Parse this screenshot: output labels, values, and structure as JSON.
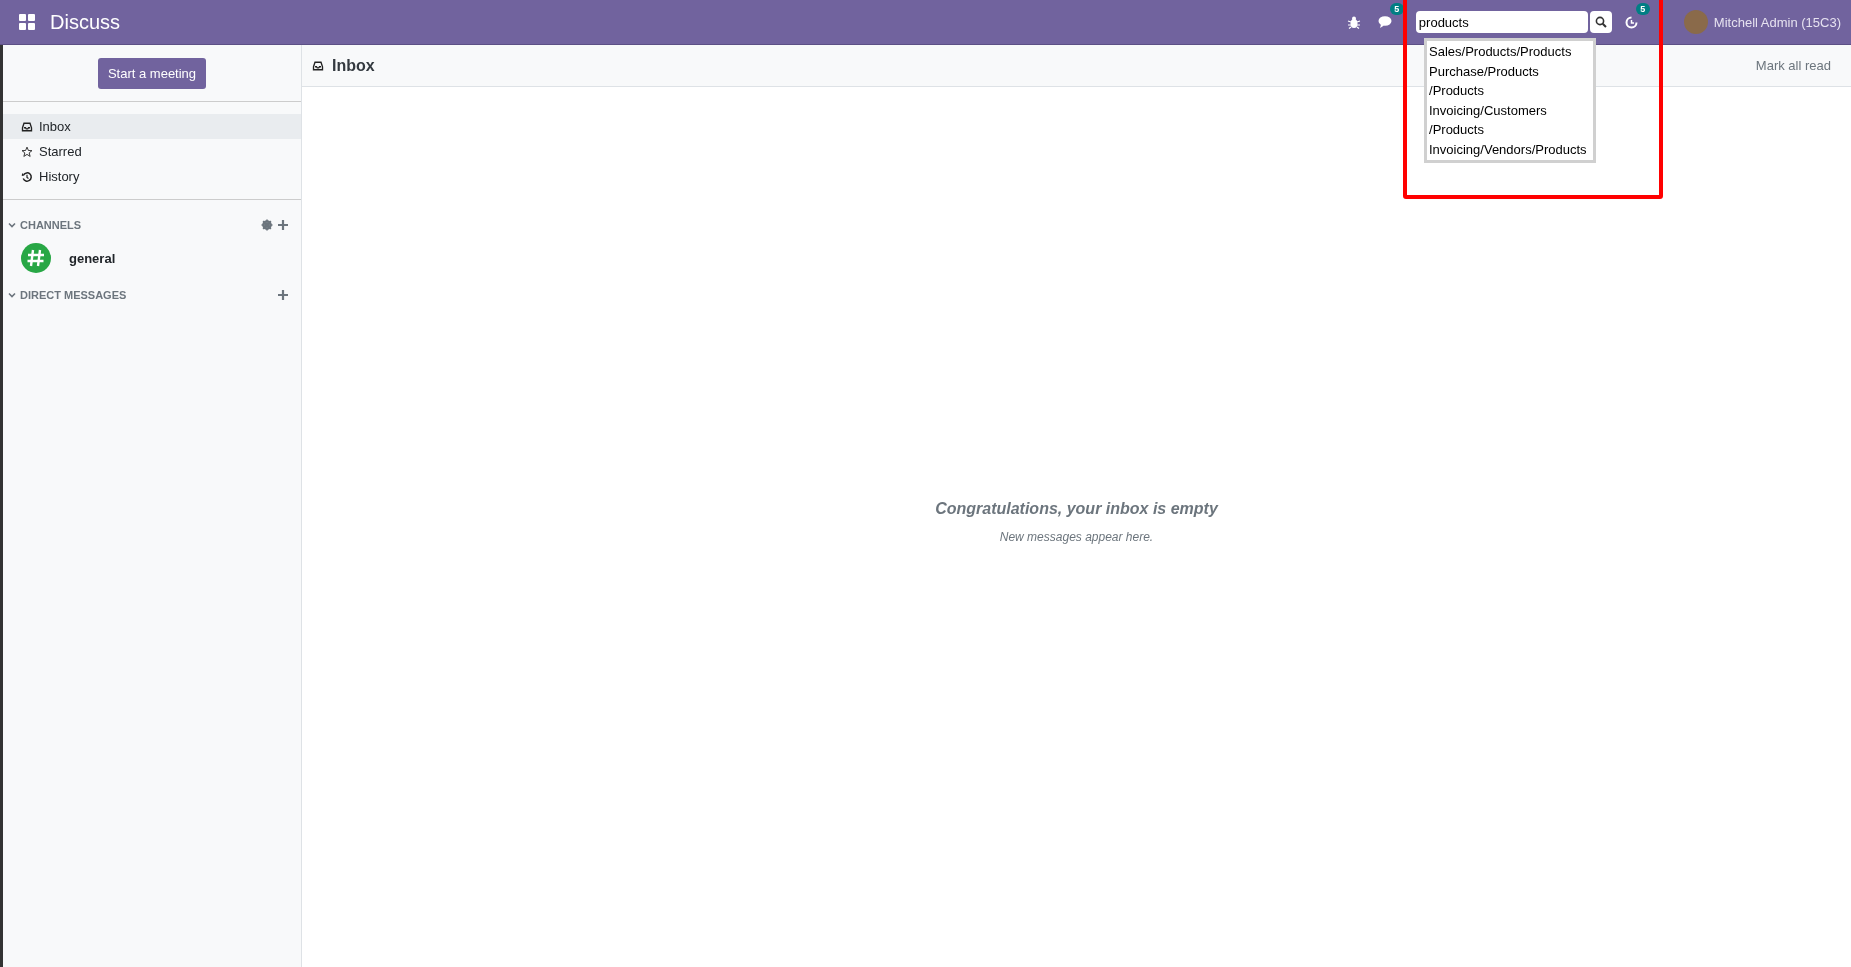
{
  "app": {
    "title": "Discuss"
  },
  "topbar": {
    "chat_badge": "5",
    "activity_badge": "5",
    "search": {
      "value": "products"
    },
    "user": "Mitchell Admin (15C3)"
  },
  "search_suggestions": [
    "Sales/Products/Products",
    "Purchase/Products/Products",
    "Invoicing/Customers/Products",
    "Invoicing/Vendors/Products"
  ],
  "sidebar": {
    "start_button": "Start a meeting",
    "items": [
      {
        "label": "Inbox",
        "selected": true
      },
      {
        "label": "Starred",
        "selected": false
      },
      {
        "label": "History",
        "selected": false
      }
    ],
    "channels": {
      "title": "CHANNELS",
      "expanded": true,
      "items": [
        {
          "name": "general"
        }
      ]
    },
    "direct_messages": {
      "title": "DIRECT MESSAGES",
      "expanded": true
    }
  },
  "main": {
    "title": "Inbox",
    "mark_all_read": "Mark all read",
    "empty_title": "Congratulations, your inbox is empty",
    "empty_text": "New messages appear here."
  }
}
